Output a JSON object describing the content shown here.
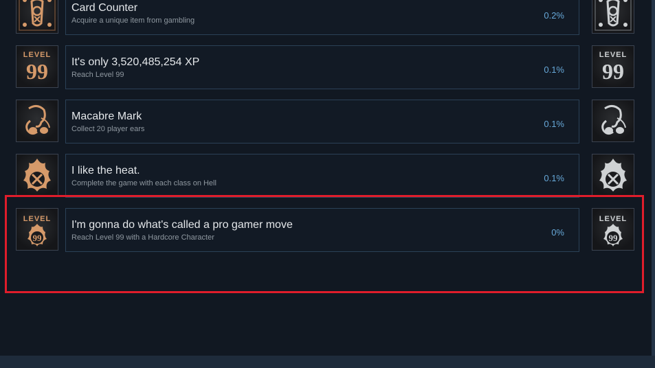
{
  "achievements": [
    {
      "title": "Card Counter",
      "description": "Acquire a unique item from gambling",
      "percent": "0.2%",
      "icon": "gambler-card-icon"
    },
    {
      "title": "It's only 3,520,485,254 XP",
      "description": "Reach Level 99",
      "percent": "0.1%",
      "icon": "level-99-icon",
      "icon_text_top": "LEVEL",
      "icon_text_bottom": "99"
    },
    {
      "title": "Macabre Mark",
      "description": "Collect 20 player ears",
      "percent": "0.1%",
      "icon": "ears-icon"
    },
    {
      "title": "I like the heat.",
      "description": "Complete the game with each class on Hell",
      "percent": "0.1%",
      "icon": "flame-swords-icon"
    },
    {
      "title": "I'm gonna do what's called a pro gamer move",
      "description": "Reach Level 99 with a Hardcore Character",
      "percent": "0%",
      "icon": "hardcore-level-99-icon",
      "icon_text_top": "LEVEL",
      "icon_text_bottom": "99"
    }
  ],
  "colors": {
    "unlocked_icon_tint": "#d69a6a",
    "locked_icon_tint": "#cfd2d4",
    "percent_text": "#67a8d8",
    "highlight": "#e01d2b"
  }
}
